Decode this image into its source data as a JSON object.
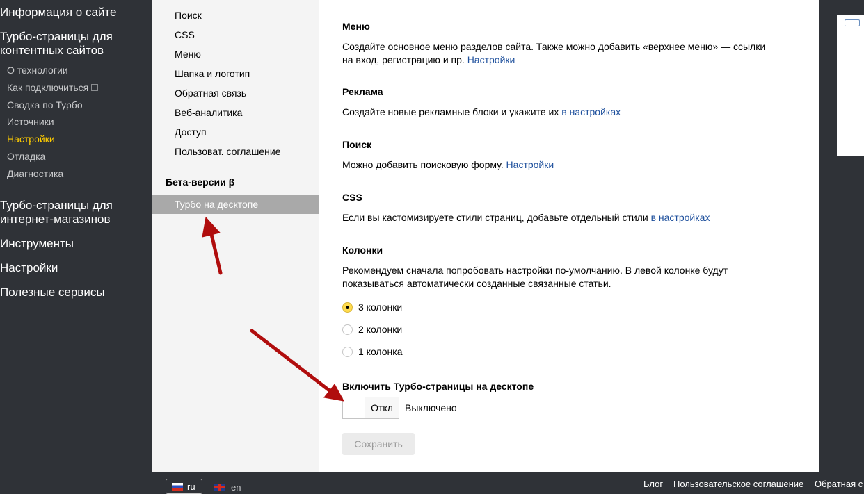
{
  "left_sidebar": {
    "site_info": "Информация о сайте",
    "turbo_content": "Турбо-страницы для\nконтентных сайтов",
    "sub_items": [
      {
        "label": "О технологии"
      },
      {
        "label": "Как подключиться"
      },
      {
        "label": "Сводка по Турбо"
      },
      {
        "label": "Источники"
      },
      {
        "label": "Настройки",
        "active": true
      },
      {
        "label": "Отладка"
      },
      {
        "label": "Диагностика"
      }
    ],
    "turbo_shops": "Турбо-страницы для\nинтернет-магазинов",
    "tools": "Инструменты",
    "settings": "Настройки",
    "useful_services": "Полезные сервисы",
    "colors": {
      "active": "#ffcc00"
    }
  },
  "middle_nav": {
    "items": [
      "Поиск",
      "CSS",
      "Меню",
      "Шапка и логотип",
      "Обратная связь",
      "Веб-аналитика",
      "Доступ",
      "Пользоват. соглашение"
    ],
    "beta_heading": "Бета-версии β",
    "active_item": "Турбо на десктопе"
  },
  "content": {
    "menu": {
      "title": "Меню",
      "text": "Создайте основное меню разделов сайта. Также можно добавить «верхнее меню» — ссылки на вход, регистрацию и пр. ",
      "link": "Настройки"
    },
    "ads": {
      "title": "Реклама",
      "text": "Создайте новые рекламные блоки и укажите их ",
      "link": "в настройках"
    },
    "search": {
      "title": "Поиск",
      "text": "Можно добавить поисковую форму. ",
      "link": "Настройки"
    },
    "css": {
      "title": "CSS",
      "text": "Если вы кастомизируете стили страниц, добавьте отдельный стили ",
      "link": "в настройках"
    },
    "columns": {
      "title": "Колонки",
      "text": "Рекомендуем сначала попробовать настройки по-умолчанию. В левой колонке будут показываться автоматически созданные связанные статьи.",
      "options": [
        {
          "label": "3 колонки",
          "checked": true
        },
        {
          "label": "2 колонки",
          "checked": false
        },
        {
          "label": "1 колонка",
          "checked": false
        }
      ]
    },
    "desktop": {
      "title": "Включить Турбо-страницы на десктопе",
      "toggle_label": "Откл",
      "state": "Выключено"
    },
    "save_label": "Сохранить",
    "colors": {
      "link": "#1d4f9c",
      "radio_checked": "#ffdb4d"
    }
  },
  "footer": {
    "lang_ru": "ru",
    "lang_en": "en",
    "links": [
      "Блог",
      "Пользовательское соглашение",
      "Обратная с"
    ]
  },
  "annotations": {
    "arrow_color": "#b00d0d"
  }
}
